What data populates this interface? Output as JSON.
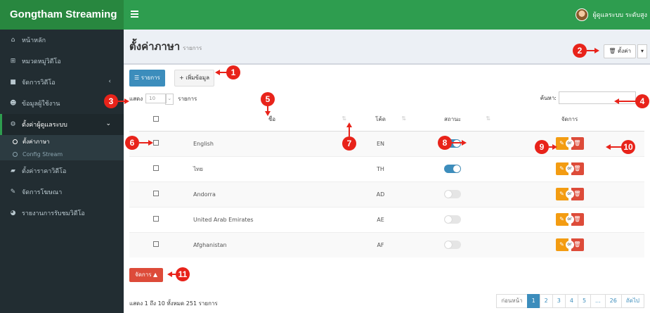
{
  "app": {
    "brand": "Gongtham Streaming",
    "user_name": "ผู้ดูแลระบบ ระดับสูง"
  },
  "colors": {
    "header": "#2e9d4f",
    "sidebar": "#222d32",
    "primary": "#3c8dbc",
    "warning": "#f39c12",
    "danger": "#dd4b39",
    "marker": "#e8231a"
  },
  "sidebar": {
    "items": [
      {
        "label": "หน้าหลัก",
        "icon": "home-icon"
      },
      {
        "label": "หมวดหมู่วิดีโอ",
        "icon": "sitemap-icon"
      },
      {
        "label": "จัดการวิดีโอ",
        "icon": "video-icon"
      },
      {
        "label": "ข้อมูลผู้ใช้งาน",
        "icon": "users-icon"
      },
      {
        "label": "ตั้งค่าผู้ดูแลระบบ",
        "icon": "cogs-icon"
      },
      {
        "label": "ตั้งค่าราคาวิดีโอ",
        "icon": "book-icon"
      },
      {
        "label": "จัดการโฆษณา",
        "icon": "edit-icon"
      },
      {
        "label": "รายงานการรับชมวิดีโอ",
        "icon": "chart-icon"
      }
    ],
    "submenu": [
      "ตั้งค่าภาษา",
      "Config Stream"
    ]
  },
  "page": {
    "title": "ตั้งค่าภาษา",
    "subtitle": "รายการ",
    "settings_button": "ตั้งค่า",
    "tab_list": "รายการ",
    "tab_add": "+ เพิ่มข้อมูล",
    "show_label": "แสดง",
    "page_length": "10",
    "entries_label": "รายการ",
    "search_label": "ค้นหา:",
    "search_placeholder": ""
  },
  "table": {
    "headers": {
      "name": "ชื่อ",
      "code": "โค้ด",
      "status": "สถานะ",
      "actions": "จัดการ"
    },
    "rows": [
      {
        "name": "English",
        "code": "EN",
        "active": true
      },
      {
        "name": "ไทย",
        "code": "TH",
        "active": true
      },
      {
        "name": "Andorra",
        "code": "AD",
        "active": false
      },
      {
        "name": "United Arab Emirates",
        "code": "AE",
        "active": false
      },
      {
        "name": "Afghanistan",
        "code": "AF",
        "active": false
      }
    ],
    "or_label": "or",
    "edit_icon": "pencil-square-icon",
    "delete_icon": "trash-icon"
  },
  "footer": {
    "bulk_button": "จัดการ ▲",
    "info": "แสดง 1 ถึง 10 ทั้งหมด 251 รายการ",
    "pagination": {
      "prev": "ก่อนหน้า",
      "pages": [
        "1",
        "2",
        "3",
        "4",
        "5",
        "...",
        "26"
      ],
      "next": "ถัดไป",
      "current": "1"
    }
  },
  "markers": [
    "1",
    "2",
    "3",
    "4",
    "5",
    "6",
    "7",
    "8",
    "9",
    "10",
    "11"
  ]
}
